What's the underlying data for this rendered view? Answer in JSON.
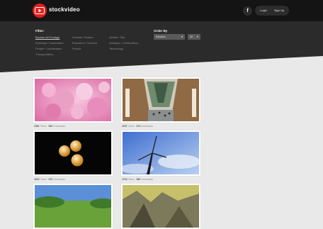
{
  "header": {
    "brand": "stockvideo",
    "facebook_label": "f",
    "login_label": "Login",
    "signup_label": "Sign Up"
  },
  "filter": {
    "label": "Filter:",
    "items": [
      "Browse All Footage",
      "Animals / Nature",
      "Aerials / Sky",
      "Buildings / Landmarks",
      "Education / Science",
      "Holidays / Celebrations",
      "People / Landscapes",
      "People",
      "Technology",
      "Transportation"
    ]
  },
  "order": {
    "label": "Order By",
    "sort_value": "Random",
    "count_value": "50"
  },
  "videos": [
    {
      "views": "1561",
      "downloads": "594"
    },
    {
      "views": "1007",
      "downloads": "374"
    },
    {
      "views": "1523",
      "downloads": "370"
    },
    {
      "views": "1718",
      "downloads": "385"
    },
    {
      "views": "",
      "downloads": ""
    },
    {
      "views": "",
      "downloads": ""
    }
  ],
  "strings": {
    "views_word": "Views ·",
    "downloads_word": "Downloads"
  },
  "colors": {
    "accent": "#e02020",
    "topbar": "#141414",
    "panel": "#2b2b2b",
    "background": "#e9e9e9"
  }
}
